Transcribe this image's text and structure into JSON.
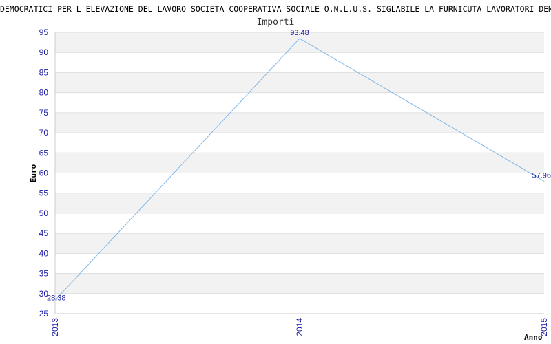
{
  "header": {
    "title": "DEMOCRATICI PER L ELEVAZIONE DEL LAVORO SOCIETA COOPERATIVA SOCIALE O.N.L.U.S. SIGLABILE LA FURNICUTA LAVORATORI DEMOCRATICI",
    "subtitle": "Importi"
  },
  "colors": {
    "line": "#7fb6e8",
    "band": "#f2f2f2",
    "tick": "#1a1aa6"
  },
  "chart_data": {
    "type": "line",
    "title": "Importi",
    "xlabel": "Anno",
    "ylabel": "Euro",
    "categories": [
      "2013",
      "2014",
      "2015"
    ],
    "values": [
      28.38,
      93.48,
      57.96
    ],
    "value_labels": [
      "28.38",
      "93.48",
      "57.96"
    ],
    "ylim": [
      25,
      95
    ],
    "yticks": [
      "25",
      "30",
      "35",
      "40",
      "45",
      "50",
      "55",
      "60",
      "65",
      "70",
      "75",
      "80",
      "85",
      "90",
      "95"
    ],
    "grid": true
  }
}
